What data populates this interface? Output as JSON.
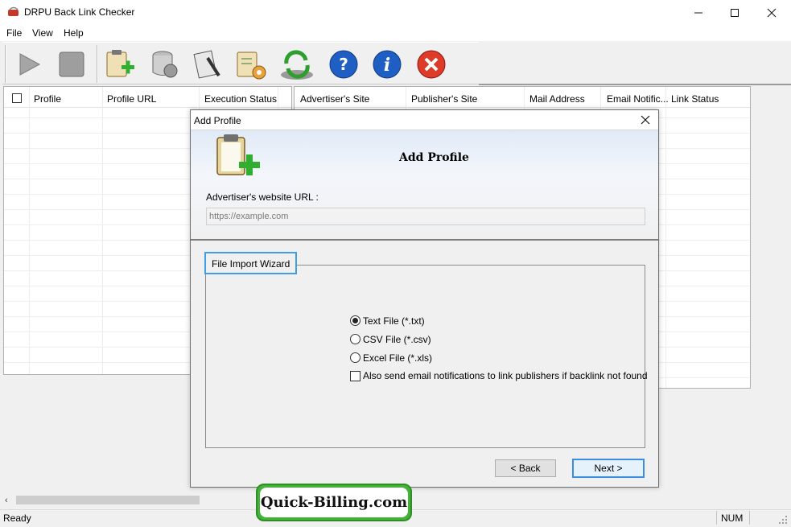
{
  "window": {
    "title": "DRPU Back Link Checker"
  },
  "menu": [
    "File",
    "View",
    "Help"
  ],
  "toolbar": {
    "buttons": [
      "play-icon",
      "stop-icon",
      "add-profile-icon",
      "database-settings-icon",
      "report-icon",
      "configure-icon",
      "refresh-icon",
      "help-icon",
      "info-icon",
      "exit-icon"
    ]
  },
  "left_grid": {
    "columns": [
      "Profile",
      "Profile URL",
      "Execution Status"
    ]
  },
  "right_grid": {
    "columns": [
      "Advertiser's Site",
      "Publisher's Site",
      "Mail Address",
      "Email Notific...",
      "Link Status"
    ]
  },
  "status": {
    "left": "Ready",
    "num": "NUM"
  },
  "dialog": {
    "title": "Add Profile",
    "heading": "Add Profile",
    "url_label": "Advertiser's website URL :",
    "url_placeholder": "https://example.com",
    "group_title": "File Import Wizard",
    "options": [
      {
        "label": "Text File (*.txt)",
        "selected": true
      },
      {
        "label": "CSV File (*.csv)",
        "selected": false
      },
      {
        "label": "Excel File (*.xls)",
        "selected": false
      }
    ],
    "email_checkbox": {
      "label": "Also send email notifications to link publishers if backlink not found",
      "checked": false
    },
    "back_label": "< Back",
    "next_label": "Next >"
  },
  "watermark": "Quick-Billing.com",
  "colors": {
    "accent": "#3b8de0",
    "badge_green": "#45b33a"
  }
}
